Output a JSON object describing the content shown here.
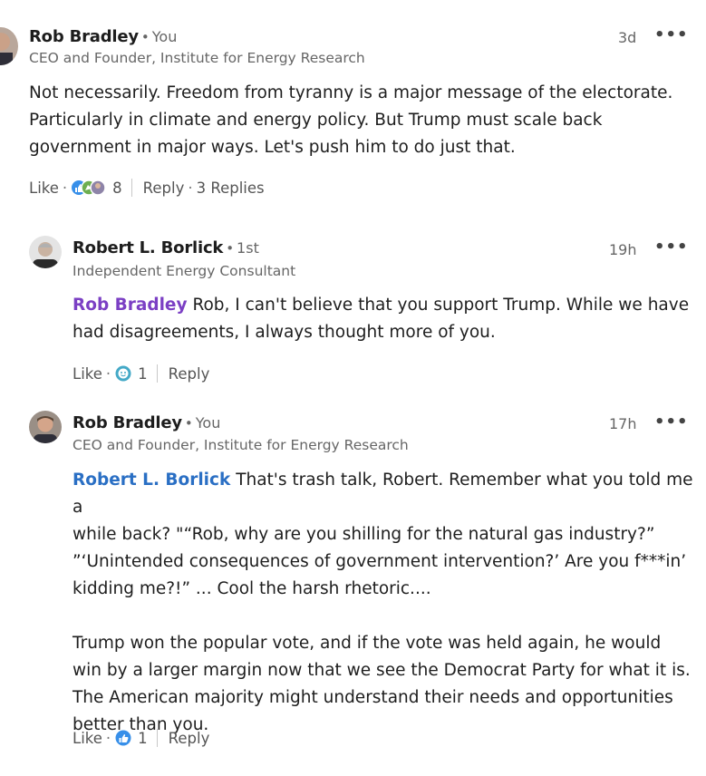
{
  "comments": [
    {
      "author": "Rob Bradley",
      "relation": "You",
      "headline": "CEO and Founder, Institute for Energy Research",
      "time": "3d",
      "more": "•••",
      "mention": "",
      "text": "Not necessarily. Freedom from tyranny is a major message of the electorate.\nParticularly in climate and energy policy. But Trump must scale back\ngovernment in major ways. Let's push him to do just that.",
      "like_label": "Like",
      "reaction_count": "8",
      "reply_label": "Reply",
      "replies_label": "3 Replies",
      "reactions": [
        "like-icon",
        "celebrate-icon",
        "avatar-icon"
      ]
    },
    {
      "author": "Robert L. Borlick",
      "relation": "1st",
      "headline": "Independent Energy Consultant",
      "time": "19h",
      "more": "•••",
      "mention": "Rob Bradley",
      "mention_color": "#7b3fc4",
      "text": "Rob, I can't believe that you support Trump. While we have\nhad disagreements, I always thought more of you.",
      "like_label": "Like",
      "reaction_count": "1",
      "reply_label": "Reply",
      "reactions": [
        "funny-icon"
      ]
    },
    {
      "author": "Rob Bradley",
      "relation": "You",
      "headline": "CEO and Founder, Institute for Energy Research",
      "time": "17h",
      "more": "•••",
      "mention": "Robert L. Borlick",
      "mention_color": "#2a6fc4",
      "text": "That's trash talk, Robert. Remember what you told me a\nwhile back? \"“Rob, why are you shilling for the natural gas industry?”\n”‘Unintended consequences of government intervention?’ Are you f***in’\nkidding me?!” ... Cool the harsh rhetoric....\n\nTrump won the popular vote, and if the vote was held again, he would\nwin by a larger margin now that we see the Democrat Party for what it is.\nThe American majority might understand their needs and opportunities\nbetter than you.",
      "like_label": "Like",
      "reaction_count": "1",
      "reply_label": "Reply",
      "reactions": [
        "like-icon"
      ]
    }
  ],
  "colors": {
    "like_blue": "#378fe9",
    "funny_teal": "#44a9c7",
    "celebrate_green": "#6dae4f"
  }
}
